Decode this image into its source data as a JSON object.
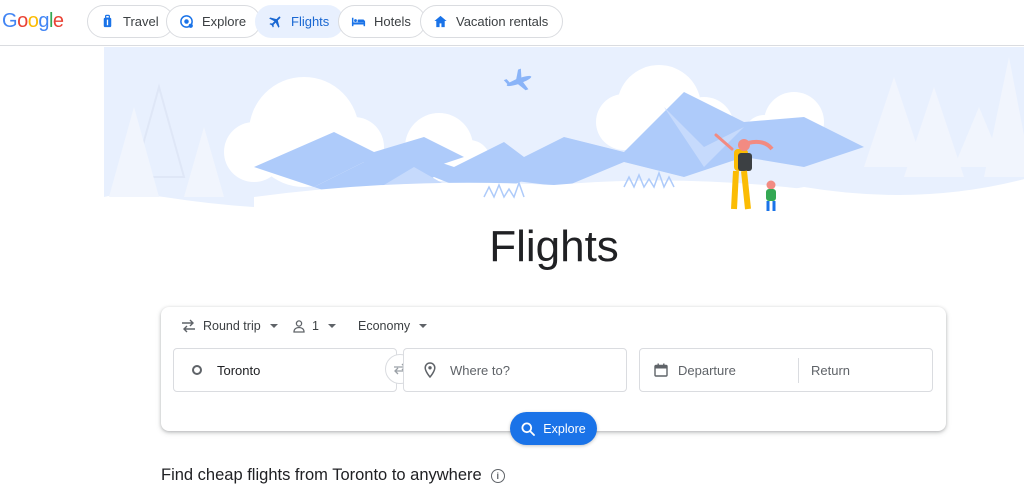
{
  "header": {
    "logo": "Google",
    "logo_colors": [
      "#4285F4",
      "#EA4335",
      "#FBBC05",
      "#4285F4",
      "#34A853",
      "#EA4335"
    ],
    "nav": [
      {
        "label": "Travel",
        "icon": "luggage-icon"
      },
      {
        "label": "Explore",
        "icon": "explore-icon"
      },
      {
        "label": "Flights",
        "icon": "airplane-icon",
        "active": true
      },
      {
        "label": "Hotels",
        "icon": "bed-icon"
      },
      {
        "label": "Vacation rentals",
        "icon": "house-icon"
      }
    ]
  },
  "main": {
    "title": "Flights",
    "search": {
      "trip_type": "Round trip",
      "passengers": "1",
      "cabin_class": "Economy",
      "origin": "Toronto",
      "destination_placeholder": "Where to?",
      "departure_placeholder": "Departure",
      "return_placeholder": "Return",
      "explore_label": "Explore"
    },
    "cheap_flights_heading": "Find cheap flights from Toronto to anywhere"
  },
  "colors": {
    "accent": "#1a73e8",
    "active_chip_bg": "#e8f0fe",
    "active_chip_text": "#1967d2",
    "hero_sky": "#e8f0fe",
    "hero_mountain": "#aecbfa"
  }
}
